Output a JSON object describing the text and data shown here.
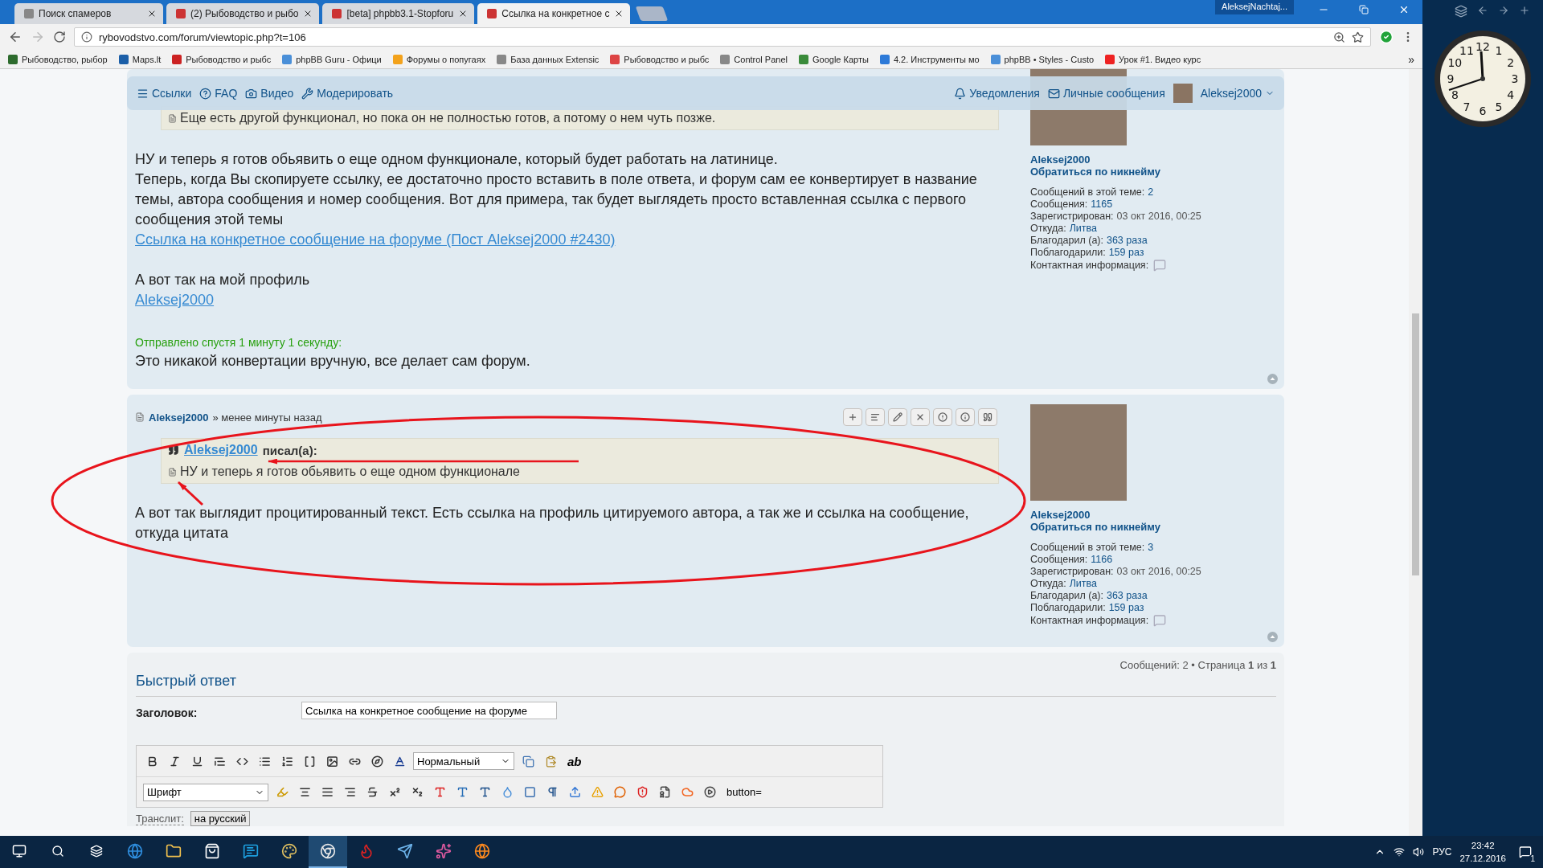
{
  "browser": {
    "tabs": [
      {
        "title": "Поиск спамеров",
        "selected": false
      },
      {
        "title": "(2) Рыбоводство и рыбо",
        "selected": false
      },
      {
        "title": "[beta] phpbb3.1-Stopforu",
        "selected": false
      },
      {
        "title": "Ссылка на конкретное с",
        "selected": true
      }
    ],
    "profile": "AleksejNachtaj...",
    "url": "rybovodstvo.com/forum/viewtopic.php?t=106",
    "bookmarks": [
      "Рыбоводство, рыбор",
      "Maps.lt",
      "Рыбоводство и рыбс",
      "phpBB Guru - Офици",
      "Форумы о попугаях",
      "База данных Extensic",
      "Рыбоводство и рыбс",
      "Control Panel",
      "Google Карты",
      "4.2. Инструменты мо",
      "phpBB • Styles - Custo",
      "Урок #1. Видео курс"
    ],
    "more": "»"
  },
  "navbar": {
    "left": [
      "Ссылки",
      "FAQ",
      "Видео",
      "Модерировать"
    ],
    "notifications": "Уведомления",
    "messages": "Личные сообщения",
    "user": "Aleksej2000"
  },
  "posts": [
    {
      "quote": {
        "text": "Еще есть другой функционал, но пока он не полностью готов, а потому о нем чуть позже."
      },
      "body": [
        {
          "kind": "text",
          "text": "НУ и теперь я готов обьявить о еще одном функционале, который будет работать на латинице."
        },
        {
          "kind": "text",
          "text": "Теперь, когда Вы скопируете ссылку, ее достаточно просто вставить в поле ответа, и форум сам ее конвертирует в название темы, автора сообщения и номер сообщения. Вот для примера, так будет выглядеть просто вставленная ссылка с первого сообщения этой темы"
        },
        {
          "kind": "link",
          "text": "Ссылка на конкретное сообщение на форуме (Пост Aleksej2000 #2430)"
        },
        {
          "kind": "gap"
        },
        {
          "kind": "text",
          "text": "А вот так на мой профиль"
        },
        {
          "kind": "link",
          "text": "Aleksej2000"
        },
        {
          "kind": "gap"
        },
        {
          "kind": "note",
          "text": "Отправлено спустя 1 минуту 1 секунду:"
        },
        {
          "kind": "text",
          "text": "Это никакой конвертации вручную, все делает сам форум."
        }
      ],
      "profile": {
        "name": "Aleksej2000",
        "mention": "Обратиться по никнейму",
        "stats": [
          {
            "label": "Сообщений в этой теме:",
            "value": "2",
            "kind": "link"
          },
          {
            "label": "Сообщения:",
            "value": "1165",
            "kind": "link"
          },
          {
            "label": "Зарегистрирован:",
            "value": "03 окт 2016, 00:25",
            "kind": "text"
          },
          {
            "label": "Откуда:",
            "value": "Литва",
            "kind": "link"
          },
          {
            "label": "Благодарил (а):",
            "value": "363 раза",
            "kind": "link"
          },
          {
            "label": "Поблагодарили:",
            "value": "159 раз",
            "kind": "link"
          }
        ],
        "contact": "Контактная информация:"
      }
    },
    {
      "header": {
        "author": "Aleksej2000",
        "time": "» менее минуты назад"
      },
      "quote": {
        "author": "Aleksej2000",
        "wrote": "писал(а):",
        "text": "НУ и теперь я готов обьявить о еще одном функционале"
      },
      "body": [
        {
          "kind": "text",
          "text": "А вот так выглядит процитированный текст. Есть ссылка на профиль цитируемого автора, а так же и ссылка на сообщение, откуда цитата"
        }
      ],
      "profile": {
        "name": "Aleksej2000",
        "mention": "Обратиться по никнейму",
        "stats": [
          {
            "label": "Сообщений в этой теме:",
            "value": "3",
            "kind": "link"
          },
          {
            "label": "Сообщения:",
            "value": "1166",
            "kind": "link"
          },
          {
            "label": "Зарегистрирован:",
            "value": "03 окт 2016, 00:25",
            "kind": "text"
          },
          {
            "label": "Откуда:",
            "value": "Литва",
            "kind": "link"
          },
          {
            "label": "Благодарил (а):",
            "value": "363 раза",
            "kind": "link"
          },
          {
            "label": "Поблагодарили:",
            "value": "159 раз",
            "kind": "link"
          }
        ],
        "contact": "Контактная информация:"
      }
    }
  ],
  "quick_reply": {
    "pagination": "Сообщений: 2 • Страница **1** из **1**",
    "title": "Быстрый ответ",
    "subject_label": "Заголовок:",
    "subject_value": "Ссылка на конкретное сообщение на форуме",
    "size_select": "Нормальный",
    "ab": "ab",
    "font_select": "Шрифт",
    "button_tag": "button=",
    "translit_label": "Транслит:",
    "translit_button": "на русский"
  },
  "taskbar": {
    "apps": [
      {
        "selected": false
      },
      {
        "selected": false
      },
      {
        "selected": false
      },
      {
        "selected": false
      },
      {
        "selected": false
      },
      {
        "selected": true
      },
      {
        "selected": false
      },
      {
        "selected": false
      },
      {
        "selected": false
      },
      {
        "selected": false
      }
    ],
    "language": "РУС",
    "time": "23:42",
    "date": "27.12.2016",
    "notifications": "1"
  },
  "clock": {
    "numerals": [
      "11",
      "12",
      "1",
      "10",
      "2",
      "9",
      "3",
      "8",
      "4",
      "7",
      "6",
      "5"
    ]
  }
}
